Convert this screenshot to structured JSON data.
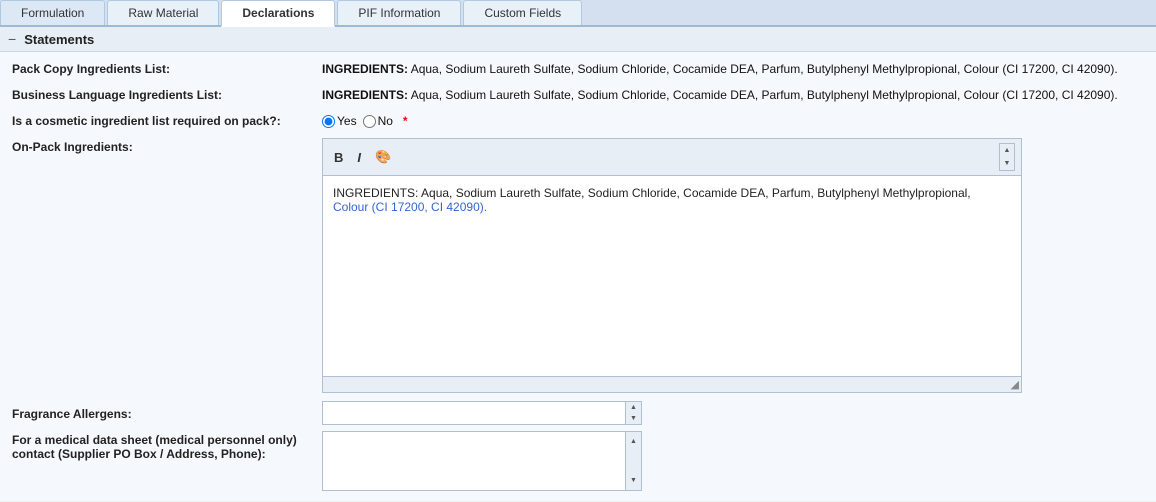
{
  "tabs": [
    {
      "id": "formulation",
      "label": "Formulation",
      "active": false
    },
    {
      "id": "raw-material",
      "label": "Raw Material",
      "active": false
    },
    {
      "id": "declarations",
      "label": "Declarations",
      "active": true
    },
    {
      "id": "pif-information",
      "label": "PIF Information",
      "active": false
    },
    {
      "id": "custom-fields",
      "label": "Custom Fields",
      "active": false
    }
  ],
  "section": {
    "title": "Statements",
    "collapse_icon": "−"
  },
  "fields": {
    "pack_copy_label": "Pack Copy Ingredients List:",
    "pack_copy_prefix": "INGREDIENTS:",
    "pack_copy_value": " Aqua, Sodium Laureth Sulfate, Sodium Chloride, Cocamide DEA, Parfum, Butylphenyl Methylpropional, Colour (CI 17200, CI 42090).",
    "business_lang_label": "Business Language Ingredients List:",
    "business_lang_prefix": "INGREDIENTS:",
    "business_lang_value": " Aqua, Sodium Laureth Sulfate, Sodium Chloride, Cocamide DEA, Parfum, Butylphenyl Methylpropional, Colour (CI 17200, CI 42090).",
    "cosmetic_required_label": "Is a cosmetic ingredient list required on pack?:",
    "cosmetic_yes": "Yes",
    "cosmetic_no": "No",
    "cosmetic_selected": "yes",
    "onpack_label": "On-Pack Ingredients:",
    "onpack_prefix": "INGREDIENTS:",
    "onpack_value": " Aqua, Sodium Laureth Sulfate, Sodium Chloride, Cocamide DEA, Parfum, Butylphenyl Methylpropional,",
    "onpack_value2": "Colour (CI 17200, CI 42090).",
    "fragrance_label": "Fragrance Allergens:",
    "medical_label": "For a medical data sheet (medical personnel only) contact (Supplier PO Box / Address, Phone):"
  },
  "toolbar": {
    "bold_label": "B",
    "italic_label": "I",
    "paint_icon": "🎨"
  },
  "icons": {
    "scroll_up": "▲",
    "scroll_down": "▼",
    "resize": "◢"
  }
}
